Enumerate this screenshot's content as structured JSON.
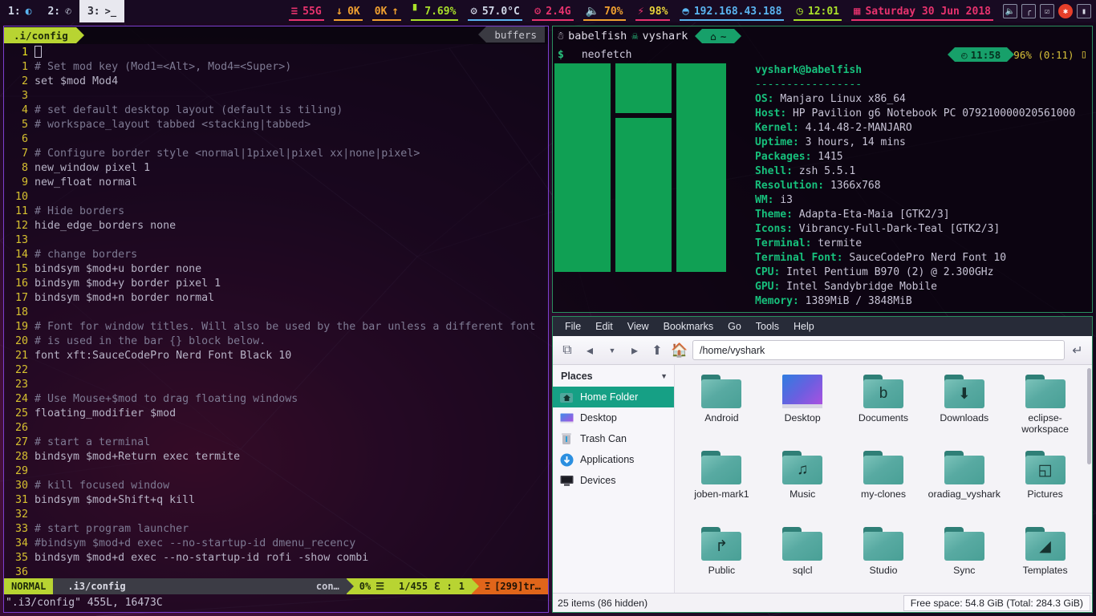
{
  "i3bar": {
    "workspaces": [
      {
        "label": "1:",
        "icon": "globe-icon",
        "glyph": "◕",
        "active": false
      },
      {
        "label": "2:",
        "icon": "whatsapp-icon",
        "glyph": "✆",
        "active": false
      },
      {
        "label": "3:",
        "icon": "terminal-icon",
        "glyph": ">_",
        "active": true
      }
    ],
    "blocks": [
      {
        "name": "disk",
        "icon": "database-icon",
        "glyph": "≡",
        "value": "55G",
        "color": "#e8336e",
        "underline": "#e8336e"
      },
      {
        "name": "net-down",
        "icon": "arrow-down-icon",
        "glyph": "↓",
        "value": "0K",
        "color": "#f0a030",
        "underline": "#f0a030"
      },
      {
        "name": "net-up",
        "icon": "arrow-up-icon",
        "glyph": "↑",
        "value": "0K",
        "color": "#f0a030",
        "underline": "#f0a030"
      },
      {
        "name": "memory",
        "icon": "memory-icon",
        "glyph": "▓",
        "value": "7.69%",
        "color": "#a9e02a",
        "underline": "#a9e02a"
      },
      {
        "name": "temperature",
        "icon": "thermometer-icon",
        "glyph": "℃",
        "value": "57.0°C",
        "color": "#5ab4f0",
        "underline": "#5ab4f0"
      },
      {
        "name": "cpu",
        "icon": "gears-icon",
        "glyph": "⚙",
        "value": "2.4G",
        "color": "#e8336e",
        "underline": "#e8336e"
      },
      {
        "name": "volume",
        "icon": "speaker-icon",
        "glyph": "◀",
        "value": "70%",
        "color": "#f0a030",
        "underline": "#f0a030"
      },
      {
        "name": "battery",
        "icon": "plug-icon",
        "glyph": "⚡",
        "value": "98%",
        "color": "#e8d23a",
        "underline": "#e8336e"
      },
      {
        "name": "wifi",
        "icon": "wifi-icon",
        "glyph": "◠",
        "value": "192.168.43.188",
        "color": "#5ab4f0",
        "underline": "#5ab4f0"
      },
      {
        "name": "clock",
        "icon": "clock-icon",
        "glyph": "◴",
        "value": "12:01",
        "color": "#a9e02a",
        "underline": "#a9e02a"
      },
      {
        "name": "date",
        "icon": "calendar-icon",
        "glyph": "▦",
        "value": "Saturday 30 Jun 2018",
        "color": "#e8336e",
        "underline": "#e8336e"
      }
    ],
    "tray": [
      {
        "name": "tray-volume-icon",
        "glyph": "◀"
      },
      {
        "name": "tray-signal-icon",
        "glyph": "▃"
      },
      {
        "name": "tray-clipboard-icon",
        "glyph": "☑"
      },
      {
        "name": "tray-update-icon",
        "glyph": "●"
      },
      {
        "name": "tray-device-icon",
        "glyph": "▯"
      }
    ]
  },
  "vim": {
    "tab_label": ".i/config",
    "buffers_label": "buffers",
    "cursor_lnum": "1",
    "lines": [
      {
        "n": "1",
        "text": "# Set mod key (Mod1=<Alt>, Mod4=<Super>)",
        "comment": true
      },
      {
        "n": "2",
        "text": "set $mod Mod4",
        "comment": false
      },
      {
        "n": "3",
        "text": "",
        "comment": false
      },
      {
        "n": "4",
        "text": "# set default desktop layout (default is tiling)",
        "comment": true
      },
      {
        "n": "5",
        "text": "# workspace_layout tabbed <stacking|tabbed>",
        "comment": true
      },
      {
        "n": "6",
        "text": "",
        "comment": false
      },
      {
        "n": "7",
        "text": "# Configure border style <normal|1pixel|pixel xx|none|pixel>",
        "comment": true
      },
      {
        "n": "8",
        "text": "new_window pixel 1",
        "comment": false
      },
      {
        "n": "9",
        "text": "new_float normal",
        "comment": false
      },
      {
        "n": "10",
        "text": "",
        "comment": false
      },
      {
        "n": "11",
        "text": "# Hide borders",
        "comment": true
      },
      {
        "n": "12",
        "text": "hide_edge_borders none",
        "comment": false
      },
      {
        "n": "13",
        "text": "",
        "comment": false
      },
      {
        "n": "14",
        "text": "# change borders",
        "comment": true
      },
      {
        "n": "15",
        "text": "bindsym $mod+u border none",
        "comment": false
      },
      {
        "n": "16",
        "text": "bindsym $mod+y border pixel 1",
        "comment": false
      },
      {
        "n": "17",
        "text": "bindsym $mod+n border normal",
        "comment": false
      },
      {
        "n": "18",
        "text": "",
        "comment": false
      },
      {
        "n": "19",
        "text": "# Font for window titles. Will also be used by the bar unless a different font",
        "comment": true
      },
      {
        "n": "20",
        "text": "# is used in the bar {} block below.",
        "comment": true
      },
      {
        "n": "21",
        "text": "font xft:SauceCodePro Nerd Font Black 10",
        "comment": false
      },
      {
        "n": "22",
        "text": "",
        "comment": false
      },
      {
        "n": "23",
        "text": "",
        "comment": false
      },
      {
        "n": "24",
        "text": "# Use Mouse+$mod to drag floating windows",
        "comment": true
      },
      {
        "n": "25",
        "text": "floating_modifier $mod",
        "comment": false
      },
      {
        "n": "26",
        "text": "",
        "comment": false
      },
      {
        "n": "27",
        "text": "# start a terminal",
        "comment": true
      },
      {
        "n": "28",
        "text": "bindsym $mod+Return exec termite",
        "comment": false
      },
      {
        "n": "29",
        "text": "",
        "comment": false
      },
      {
        "n": "30",
        "text": "# kill focused window",
        "comment": true
      },
      {
        "n": "31",
        "text": "bindsym $mod+Shift+q kill",
        "comment": false
      },
      {
        "n": "32",
        "text": "",
        "comment": false
      },
      {
        "n": "33",
        "text": "# start program launcher",
        "comment": true
      },
      {
        "n": "34",
        "text": "#bindsym $mod+d exec --no-startup-id dmenu_recency",
        "comment": true
      },
      {
        "n": "35",
        "text": "bindsym $mod+d exec --no-startup-id rofi -show combi",
        "comment": false
      },
      {
        "n": "36",
        "text": "",
        "comment": false
      }
    ],
    "statusline": {
      "mode": "NORMAL",
      "filename": ".i3/config",
      "filetype": "con…",
      "percent": "0%",
      "percent_icon": "☰",
      "position": "1/455",
      "position_icon": "ℇ",
      "column_sep": ":",
      "column": "1",
      "warning_icon": "Ξ",
      "warning": "[299]tr…"
    },
    "cmdline": "\".i3/config\" 455L, 16473C"
  },
  "terminal": {
    "host_icon": "☃",
    "host": "babelfish",
    "user_icon": "☠",
    "user": "vyshark",
    "path_icon": "⌂",
    "path": "~",
    "prompt_symbol": "$",
    "command": "neofetch",
    "rprompt_clock_icon": "◴",
    "rprompt_clock": "11:58",
    "rprompt_battery": "96% (0:11)",
    "rprompt_battery_icon": "▯",
    "neofetch": {
      "title": "vyshark@babelfish",
      "rule": "-----------------",
      "rows": [
        {
          "key": "OS",
          "value": "Manjaro Linux x86_64"
        },
        {
          "key": "Host",
          "value": "HP Pavilion g6 Notebook PC 079210000020561000"
        },
        {
          "key": "Kernel",
          "value": "4.14.48-2-MANJARO"
        },
        {
          "key": "Uptime",
          "value": "3 hours, 14 mins"
        },
        {
          "key": "Packages",
          "value": "1415"
        },
        {
          "key": "Shell",
          "value": "zsh 5.5.1"
        },
        {
          "key": "Resolution",
          "value": "1366x768"
        },
        {
          "key": "WM",
          "value": "i3"
        },
        {
          "key": "Theme",
          "value": "Adapta-Eta-Maia [GTK2/3]"
        },
        {
          "key": "Icons",
          "value": "Vibrancy-Full-Dark-Teal [GTK2/3]"
        },
        {
          "key": "Terminal",
          "value": "termite"
        },
        {
          "key": "Terminal Font",
          "value": "SauceCodePro Nerd Font 10"
        },
        {
          "key": "CPU",
          "value": "Intel Pentium B970 (2) @ 2.300GHz"
        },
        {
          "key": "GPU",
          "value": "Intel Sandybridge Mobile"
        },
        {
          "key": "Memory",
          "value": "1389MiB / 3848MiB"
        }
      ],
      "logo_color": "#10a054"
    }
  },
  "filemanager": {
    "menu": [
      "File",
      "Edit",
      "View",
      "Bookmarks",
      "Go",
      "Tools",
      "Help"
    ],
    "toolbar_icons": [
      {
        "name": "new-tab-icon",
        "glyph": "⧉"
      },
      {
        "name": "back-icon",
        "glyph": "◀"
      },
      {
        "name": "history-dropdown-icon",
        "glyph": "▼"
      },
      {
        "name": "forward-icon",
        "glyph": "▶"
      },
      {
        "name": "up-icon",
        "glyph": "⬆"
      },
      {
        "name": "home-icon",
        "glyph": "⌂"
      }
    ],
    "path": "/home/vyshark",
    "path_go_icon": "↵",
    "places_header": "Places",
    "places_collapse_icon": "▼",
    "places": [
      {
        "label": "Home Folder",
        "icon": "home-folder-icon",
        "selected": true
      },
      {
        "label": "Desktop",
        "icon": "desktop-icon",
        "selected": false
      },
      {
        "label": "Trash Can",
        "icon": "trash-icon",
        "selected": false
      },
      {
        "label": "Applications",
        "icon": "applications-icon",
        "selected": false
      },
      {
        "label": "Devices",
        "icon": "devices-icon",
        "selected": false
      }
    ],
    "files": [
      {
        "label": "Android",
        "icon": "folder-icon",
        "glyph": ""
      },
      {
        "label": "Desktop",
        "icon": "desktop-folder-icon",
        "glyph": ""
      },
      {
        "label": "Documents",
        "icon": "documents-folder-icon",
        "glyph": "὜b"
      },
      {
        "label": "Downloads",
        "icon": "downloads-folder-icon",
        "glyph": "⬇"
      },
      {
        "label": "eclipse-workspace",
        "icon": "folder-icon",
        "glyph": ""
      },
      {
        "label": "joben-mark1",
        "icon": "folder-icon",
        "glyph": ""
      },
      {
        "label": "Music",
        "icon": "music-folder-icon",
        "glyph": "♫"
      },
      {
        "label": "my-clones",
        "icon": "folder-icon",
        "glyph": ""
      },
      {
        "label": "oradiag_vyshark",
        "icon": "folder-icon",
        "glyph": ""
      },
      {
        "label": "Pictures",
        "icon": "pictures-folder-icon",
        "glyph": "◱"
      },
      {
        "label": "Public",
        "icon": "public-folder-icon",
        "glyph": "↱"
      },
      {
        "label": "sqlcl",
        "icon": "folder-icon",
        "glyph": ""
      },
      {
        "label": "Studio",
        "icon": "folder-icon",
        "glyph": ""
      },
      {
        "label": "Sync",
        "icon": "folder-icon",
        "glyph": ""
      },
      {
        "label": "Templates",
        "icon": "templates-folder-icon",
        "glyph": "◢"
      }
    ],
    "status_items": "25 items (86 hidden)",
    "status_free": "Free space: 54.8 GiB (Total: 284.3 GiB)"
  }
}
